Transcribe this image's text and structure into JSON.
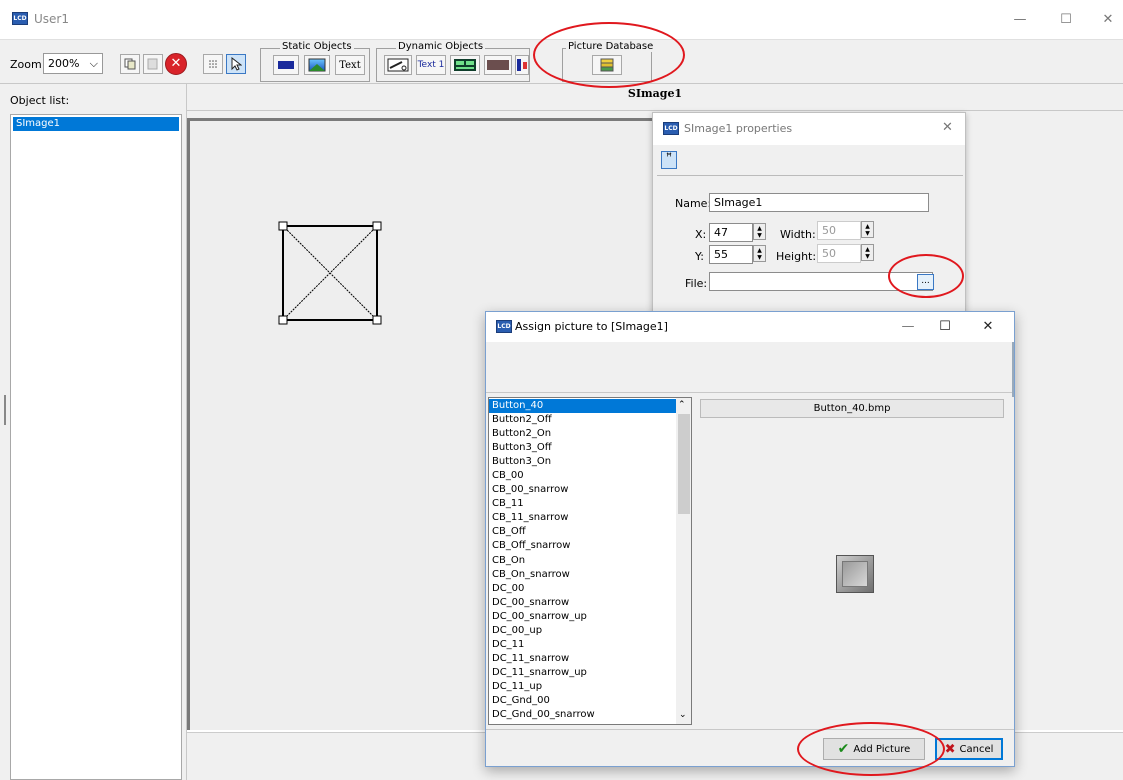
{
  "window": {
    "title": "User1"
  },
  "toolbar": {
    "zoom_label": "Zoom:",
    "zoom_value": "200%",
    "static_objects_label": "Static Objects",
    "static_text_button": "Text",
    "dynamic_objects_label": "Dynamic Objects",
    "dynamic_text_button": "Text 1",
    "picture_database_label": "Picture Database"
  },
  "object_list": {
    "label": "Object list:",
    "items": [
      "SImage1"
    ]
  },
  "canvas": {
    "header": "SImage1"
  },
  "properties": {
    "title": "SImage1 properties",
    "pin_icon": "pin-icon",
    "name_label": "Name:",
    "name_value": "SImage1",
    "x_label": "X:",
    "x_value": "47",
    "y_label": "Y:",
    "y_value": "55",
    "width_label": "Width:",
    "width_value": "50",
    "height_label": "Height:",
    "height_value": "50",
    "file_label": "File:",
    "file_value": "",
    "browse_label": "..."
  },
  "assign_dialog": {
    "title": "Assign picture to [SImage1]",
    "preview_filename": "Button_40.bmp",
    "items": [
      "Button_40",
      "Button2_Off",
      "Button2_On",
      "Button3_Off",
      "Button3_On",
      "CB_00",
      "CB_00_snarrow",
      "CB_11",
      "CB_11_snarrow",
      "CB_Off",
      "CB_Off_snarrow",
      "CB_On",
      "CB_On_snarrow",
      "DC_00",
      "DC_00_snarrow",
      "DC_00_snarrow_up",
      "DC_00_up",
      "DC_11",
      "DC_11_snarrow",
      "DC_11_snarrow_up",
      "DC_11_up",
      "DC_Gnd_00",
      "DC_Gnd_00_snarrow"
    ],
    "add_picture_label": "Add Picture",
    "cancel_label": "Cancel"
  },
  "colors": {
    "selection": "#0078d7",
    "highlight": "#e0181e"
  }
}
